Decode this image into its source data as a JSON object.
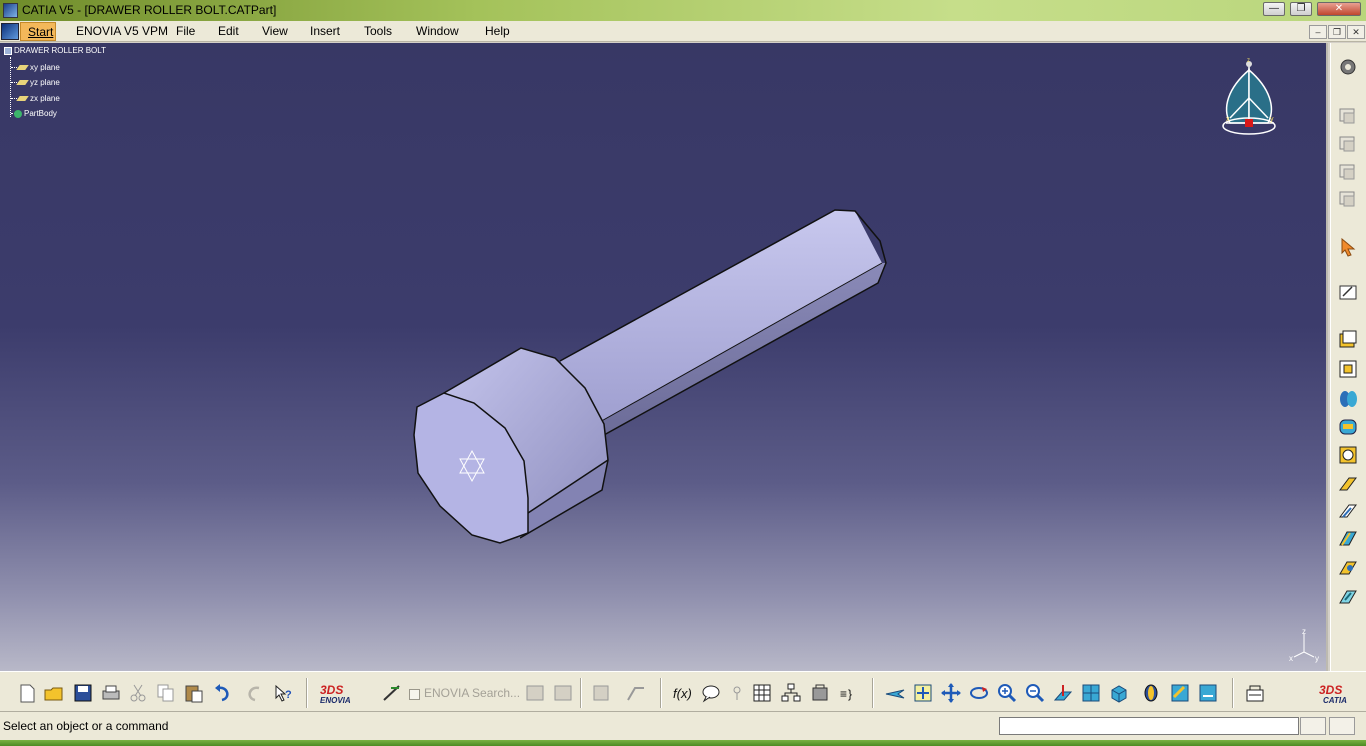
{
  "window": {
    "title": "CATIA V5 - [DRAWER ROLLER BOLT.CATPart]",
    "controls": [
      "minimize",
      "restore",
      "close"
    ]
  },
  "menubar": {
    "items": [
      "Start",
      "ENOVIA V5 VPM",
      "File",
      "Edit",
      "View",
      "Insert",
      "Tools",
      "Window",
      "Help"
    ]
  },
  "tree": {
    "root": "DRAWER ROLLER BOLT",
    "children": [
      "xy plane",
      "yz plane",
      "zx plane",
      "PartBody"
    ]
  },
  "compass": {
    "axes": [
      "x",
      "y",
      "z"
    ]
  },
  "axis_triad": {
    "labels": [
      "z",
      "x",
      "y"
    ]
  },
  "right_toolbar": {
    "icons": [
      "sketcher-icon",
      "pad-icon",
      "pocket-icon",
      "shaft-icon",
      "groove-icon",
      "hole-icon",
      "rib-icon",
      "slot-icon",
      "stiffener-icon",
      "multi-section-solid-icon",
      "fillet-icon",
      "chamfer-icon",
      "draft-icon",
      "shell-icon",
      "thickness-icon",
      "thread-icon",
      "select-icon",
      "compass-icon"
    ]
  },
  "bottom_toolbar": {
    "enovia_search_placeholder": "ENOVIA Search...",
    "groups": {
      "standard": [
        "new-icon",
        "open-icon",
        "save-icon",
        "print-icon",
        "cut-icon",
        "copy-icon",
        "paste-icon",
        "undo-icon",
        "redo-icon",
        "whats-this-icon"
      ],
      "enovia": [
        "enovia-logo-icon",
        "enovia-tool-icon",
        "enovia-checkbox-icon"
      ],
      "tools": [
        "formula-icon",
        "comment-icon",
        "publication-icon",
        "table-icon",
        "tree-icon",
        "library-icon",
        "macro-icon"
      ],
      "view": [
        "fly-icon",
        "fit-all-icon",
        "pan-icon",
        "rotate-icon",
        "zoom-in-icon",
        "zoom-out-icon",
        "normal-view-icon",
        "multi-view-icon",
        "iso-view-icon",
        "shading-icon",
        "hide-show-icon",
        "swap-visible-space-icon"
      ],
      "catia": [
        "catia-logo-icon"
      ]
    }
  },
  "statusbar": {
    "message": "Select an object or a command",
    "command_input_value": ""
  },
  "colors": {
    "viewport_top": "#383865",
    "viewport_bottom": "#b8b8c8",
    "part_face": "#b4b4e4",
    "titlebar": "#a4c25a",
    "menubar": "#ece9d8",
    "start_highlight": "#f3b85a"
  }
}
